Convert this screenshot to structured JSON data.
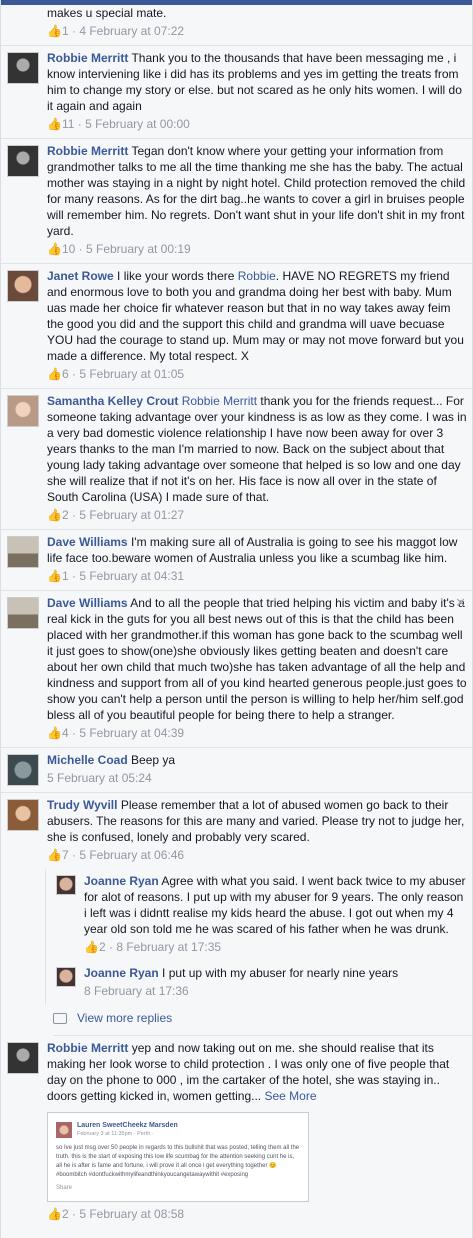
{
  "comments": [
    {
      "id": "c0",
      "text": "makes u special mate.",
      "likes": "1",
      "time": "4 February at 07:22"
    },
    {
      "id": "c1",
      "name": "Robbie Merritt",
      "text": "Thank you to the thousands that have been messaging me , i know interviening like i did has its problems and yes im getting the treats from him to change my story or else. but not scared as he only hits women. I will do it again and again",
      "likes": "11",
      "time": "5 February at 00:00"
    },
    {
      "id": "c2",
      "name": "Robbie Merritt",
      "text": "Tegan don't know where your getting your information from grandmother talks to me all the time thanking me she has the baby. The actual mother was staying in a night by night hotel. Child protection removed the child for many reasons. As for the dirt bag..he wants to cover a girl in bruises people will remember him. No regrets. Don't want shut in your life don't shit in my front yard.",
      "likes": "10",
      "time": "5 February at 00:19"
    },
    {
      "id": "c3",
      "name": "Janet Rowe",
      "text_a": "I like your words there",
      "mention": "Robbie",
      "text_b": ". HAVE NO REGRETS my friend and enormous love to both you and grandma doing her best with baby. Mum uas made her choice fir whatever reason but that in no way takes away feim the good you did and the support this child and grandma will uave becuase YOU had the courage to stand up. Mum may or may not move forward but you made a difference. My total respect. X",
      "likes": "6",
      "time": "5 February at 01:05"
    },
    {
      "id": "c4",
      "name": "Samantha Kelley Crout",
      "mention": "Robbie Merritt",
      "text": "thank you for the friends request... For someone taking advantage over your kindness is as low as they come. I was in a very bad domestic violence relationship I have now been away for over 3 years thanks to the man I'm married to now. Back on the subject about that young lady taking advantage over someone that helped is so low and one day she will realize that if not it's on her. His face is now all over in the state of South Carolina (USA) I made sure of that.",
      "likes": "2",
      "time": "5 February at 01:27"
    },
    {
      "id": "c5",
      "name": "Dave Williams",
      "text": "I'm making sure all of Australia is going to see his maggot low life face too.beware women of Australia unless you like a scumbag like him.",
      "likes": "1",
      "time": "5 February at 04:31"
    },
    {
      "id": "c6",
      "name": "Dave Williams",
      "text": "And to all the people that tried helping his victim and baby it's a real kick in the guts for you all best news out of this is that the child has been placed with her grandmother.if this woman has gone back to the scumbag well it just goes to show(one)she obviously likes getting beaten and doesn't care about her own child that much two)she has taken advantage of all the help and kindness and support from all of you kind hearted generous people.just goes to show you can't help a person until the person is willing to help her/him self.god bless all of you beautiful people for being there to help a stranger.",
      "likes": "4",
      "time": "5 February at 04:39"
    },
    {
      "id": "c7",
      "name": "Michelle Coad",
      "text": "Beep ya",
      "time": "5 February at 05:24"
    },
    {
      "id": "c8",
      "name": "Trudy Wyvill",
      "text": "Please remember that a lot of abused women go back to their abusers. The reasons for this are many and varied. Please try not to judge her, she is confused, lonely and probably very scared.",
      "likes": "7",
      "time": "5 February at 06:46"
    }
  ],
  "replies": [
    {
      "id": "r1",
      "name": "Joanne Ryan",
      "text": "Agree with what you said. I went back twice to my abuser for alot of reasons. I put up with my abuser for 9 years. The only reason i left was i didntt realise my kids heard the abuse. I got out when my 4 year old son told me he was scared of his father when he was drunk.",
      "likes": "2",
      "time": "8 February at 17:35"
    },
    {
      "id": "r2",
      "name": "Joanne Ryan",
      "text": "I put up with my abuser for nearly nine years",
      "time": "8 February at 17:36"
    }
  ],
  "view_more": "View more replies",
  "last": {
    "name": "Robbie Merritt",
    "text": "yep and now taking out on me. she should realise that its making her look worse to child protection . I was only one of five people that day on the phone to 000 , im the cartaker of the hotel, she was staying in.. doors getting kicked in, women getting...",
    "see_more": "See More",
    "likes": "2",
    "time": "5 February at 08:58",
    "embed": {
      "name": "Lauren SweetCheekz Marsden",
      "time": "February 3 at 11:35pm · Perth ·",
      "text": "so Ive just msg over 50 people in regards to this bullshit that was posted, telling them all the truth. this is the start of exposing this low life scumbag for the attention seeking cunt he is, all he is after is fame and fortune, i will prove it all once i get everything together 😊 #boombitch #dontfuckwithmylifeandthinkyoucangetawaywithit #exposing",
      "share": "Share"
    }
  }
}
